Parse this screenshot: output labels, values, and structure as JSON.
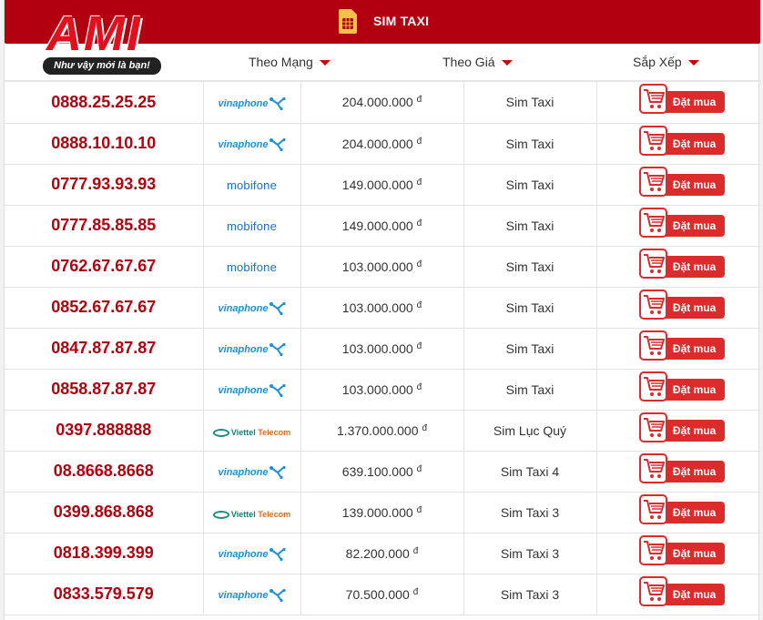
{
  "header": {
    "title": "SIM TAXI",
    "sim_icon": "sim-card-icon",
    "brand_color": "#b30010"
  },
  "logo": {
    "text": "AMI",
    "slogan": "Như vậy mới là bạn!"
  },
  "filters": [
    {
      "label": "Theo Mạng"
    },
    {
      "label": "Theo Giá"
    },
    {
      "label": "Sắp Xếp"
    }
  ],
  "currency_symbol": "đ",
  "buy_label": "Đặt mua",
  "rows": [
    {
      "number": "0888.25.25.25",
      "network": "vinaphone",
      "price": "204.000.000",
      "type": "Sim Taxi"
    },
    {
      "number": "0888.10.10.10",
      "network": "vinaphone",
      "price": "204.000.000",
      "type": "Sim Taxi"
    },
    {
      "number": "0777.93.93.93",
      "network": "mobifone",
      "price": "149.000.000",
      "type": "Sim Taxi"
    },
    {
      "number": "0777.85.85.85",
      "network": "mobifone",
      "price": "149.000.000",
      "type": "Sim Taxi"
    },
    {
      "number": "0762.67.67.67",
      "network": "mobifone",
      "price": "103.000.000",
      "type": "Sim Taxi"
    },
    {
      "number": "0852.67.67.67",
      "network": "vinaphone",
      "price": "103.000.000",
      "type": "Sim Taxi"
    },
    {
      "number": "0847.87.87.87",
      "network": "vinaphone",
      "price": "103.000.000",
      "type": "Sim Taxi"
    },
    {
      "number": "0858.87.87.87",
      "network": "vinaphone",
      "price": "103.000.000",
      "type": "Sim Taxi"
    },
    {
      "number": "0397.888888",
      "network": "viettel",
      "price": "1.370.000.000",
      "type": "Sim Lục Quý"
    },
    {
      "number": "08.8668.8668",
      "network": "vinaphone",
      "price": "639.100.000",
      "type": "Sim Taxi 4"
    },
    {
      "number": "0399.868.868",
      "network": "viettel",
      "price": "139.000.000",
      "type": "Sim Taxi 3"
    },
    {
      "number": "0818.399.399",
      "network": "vinaphone",
      "price": "82.200.000",
      "type": "Sim Taxi 3"
    },
    {
      "number": "0833.579.579",
      "network": "vinaphone",
      "price": "70.500.000",
      "type": "Sim Taxi 3"
    }
  ],
  "network_logos": {
    "vinaphone": "vinaphone",
    "mobifone": "mobifone",
    "viettel_a": "Viettel",
    "viettel_b": "Telecom"
  }
}
